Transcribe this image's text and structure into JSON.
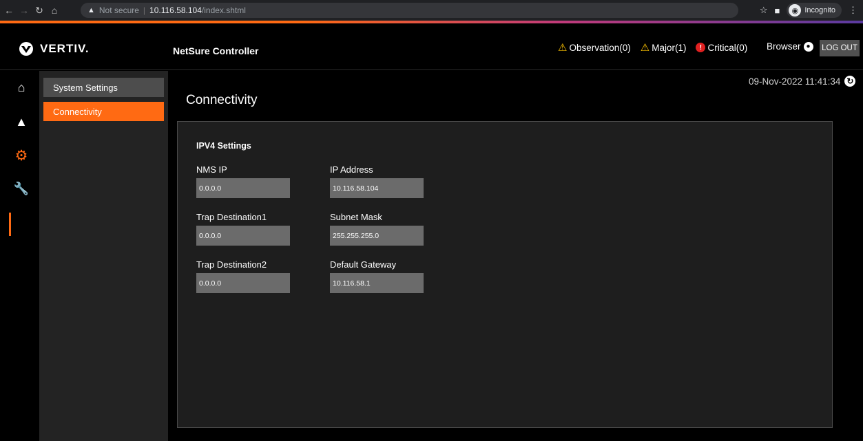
{
  "browser": {
    "security_label": "Not secure",
    "url_host": "10.116.58.104",
    "url_path": "/index.shtml",
    "incognito_label": "Incognito"
  },
  "header": {
    "logo_text": "VERTIV.",
    "app_title": "NetSure Controller",
    "alarms": {
      "observation": "Observation(0)",
      "major": "Major(1)",
      "critical": "Critical(0)"
    },
    "user_label": "Browser",
    "logout_label": "LOG OUT"
  },
  "colors": {
    "accent": "#ff6a13",
    "warning": "#ffc400",
    "critical": "#e02020"
  },
  "rail": {
    "icons": [
      "home-icon",
      "alarm-icon",
      "settings-icon",
      "maintenance-icon"
    ],
    "active": "settings-icon"
  },
  "subnav": {
    "items": [
      {
        "label": "System Settings",
        "active": false
      },
      {
        "label": "Connectivity",
        "active": true
      }
    ]
  },
  "main": {
    "datetime": "09-Nov-2022 11:41:34",
    "page_title": "Connectivity",
    "section_title": "IPV4 Settings",
    "fields": {
      "nms_ip": {
        "label": "NMS IP",
        "value": "0.0.0.0"
      },
      "ip_address": {
        "label": "IP Address",
        "value": "10.116.58.104"
      },
      "trap_dest1": {
        "label": "Trap Destination1",
        "value": "0.0.0.0"
      },
      "subnet_mask": {
        "label": "Subnet Mask",
        "value": "255.255.255.0"
      },
      "trap_dest2": {
        "label": "Trap Destination2",
        "value": "0.0.0.0"
      },
      "default_gateway": {
        "label": "Default Gateway",
        "value": "10.116.58.1"
      }
    }
  }
}
